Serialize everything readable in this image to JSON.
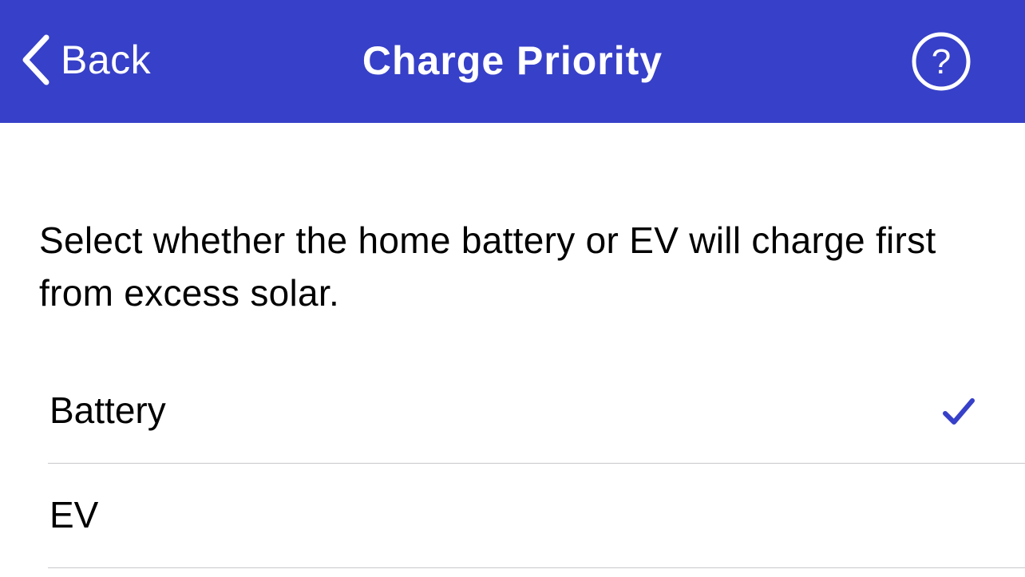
{
  "nav": {
    "back_label": "Back",
    "title": "Charge Priority",
    "help_icon": "question-circle-icon",
    "back_icon": "chevron-left-icon",
    "background_color": "#3740c8"
  },
  "description": "Select whether the home battery or EV will charge first from excess solar.",
  "options": [
    {
      "label": "Battery",
      "selected": true
    },
    {
      "label": "EV",
      "selected": false
    }
  ],
  "accent_color": "#3740c8",
  "check_icon": "checkmark-icon"
}
